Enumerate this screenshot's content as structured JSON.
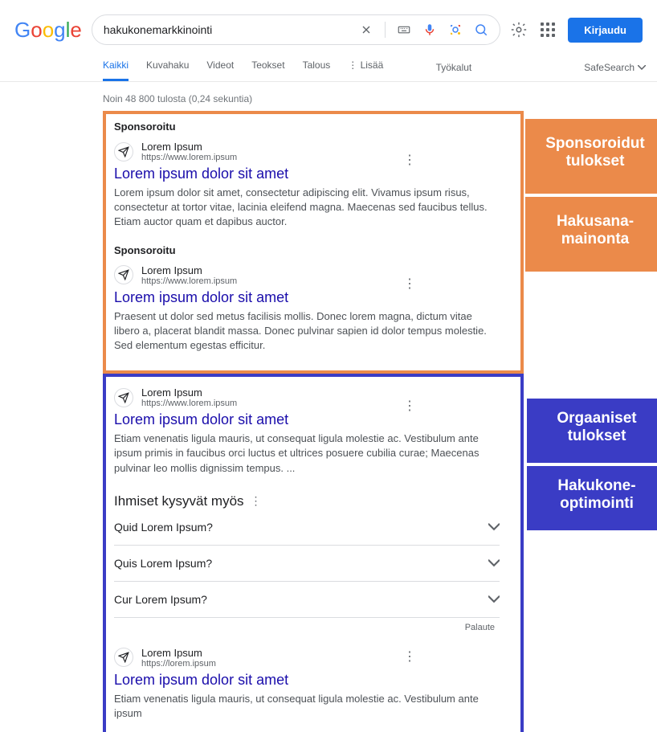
{
  "search": {
    "query": "hakukonemarkkinointi"
  },
  "signin_label": "Kirjaudu",
  "tabs": {
    "all": "Kaikki",
    "images": "Kuvahaku",
    "videos": "Videot",
    "products": "Teokset",
    "finance": "Talous",
    "more": "Lisää",
    "tools": "Työkalut",
    "safesearch": "SafeSearch"
  },
  "stats": "Noin 48 800 tulosta (0,24 sekuntia)",
  "sponsored_label": "Sponsoroitu",
  "results": {
    "r1": {
      "site": "Lorem Ipsum",
      "url": "https://www.lorem.ipsum",
      "title": "Lorem ipsum dolor sit amet",
      "desc": "Lorem ipsum dolor sit amet, consectetur adipiscing elit. Vivamus ipsum risus, consectetur at tortor vitae, lacinia eleifend magna. Maecenas sed faucibus tellus. Etiam auctor quam et dapibus auctor."
    },
    "r2": {
      "site": "Lorem Ipsum",
      "url": "https://www.lorem.ipsum",
      "title": "Lorem ipsum dolor sit amet",
      "desc": "Praesent ut dolor sed metus facilisis mollis. Donec lorem magna, dictum vitae libero a, placerat blandit massa. Donec pulvinar sapien id dolor tempus molestie. Sed elementum egestas efficitur."
    },
    "r3": {
      "site": "Lorem Ipsum",
      "url": "https://www.lorem.ipsum",
      "title": "Lorem ipsum dolor sit amet",
      "desc": "Etiam venenatis ligula mauris, ut consequat ligula molestie ac. Vestibulum ante ipsum primis in faucibus orci luctus et ultrices posuere cubilia curae; Maecenas pulvinar leo mollis dignissim tempus. ..."
    },
    "r4": {
      "site": "Lorem Ipsum",
      "url": "https://lorem.ipsum",
      "title": "Lorem ipsum dolor sit amet",
      "desc": "Etiam venenatis ligula mauris, ut consequat ligula molestie ac. Vestibulum ante ipsum"
    }
  },
  "paa": {
    "title": "Ihmiset kysyvät myös",
    "q1": "Quid Lorem Ipsum?",
    "q2": "Quis Lorem Ipsum?",
    "q3": "Cur Lorem Ipsum?",
    "feedback": "Palaute"
  },
  "callouts": {
    "sponsored_results": "Sponsoroidut tulokset",
    "search_ads_1": "Hakusana-",
    "search_ads_2": "mainonta",
    "organic_results": "Orgaaniset tulokset",
    "seo_1": "Hakukone-",
    "seo_2": "optimointi"
  }
}
